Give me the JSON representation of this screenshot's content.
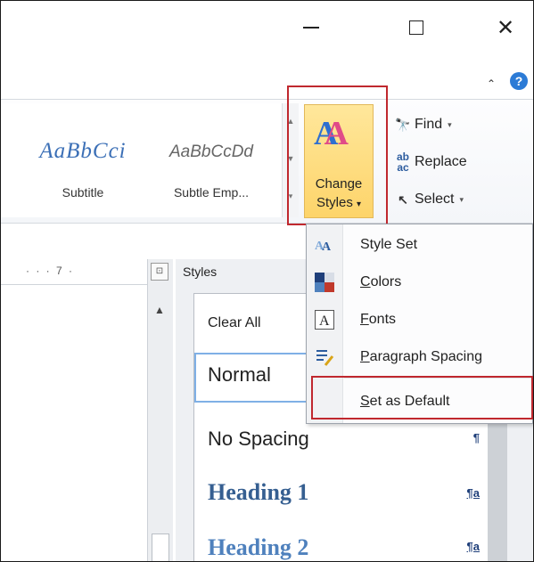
{
  "window": {
    "minimize_glyph": "—",
    "close_glyph": "✕",
    "help_glyph": "?",
    "collapse_glyph": "⌃"
  },
  "ribbon": {
    "style_gallery": [
      {
        "sample": "AaBbCci",
        "label": "Subtitle"
      },
      {
        "sample": "AaBbCcDd",
        "label": "Subtle Emp..."
      }
    ],
    "change_styles": {
      "label_line1": "Change",
      "label_line2": "Styles",
      "arrow": "▾"
    },
    "editing": [
      {
        "icon": "find-icon",
        "label": "Find",
        "arrow": "▾"
      },
      {
        "icon": "replace-icon",
        "label": "Replace",
        "arrow": ""
      },
      {
        "icon": "select-icon",
        "label": "Select",
        "arrow": "▾"
      }
    ]
  },
  "ruler": {
    "text": "·  ·  ·  7  ·"
  },
  "change_styles_menu": [
    {
      "icon": "style-set-icon",
      "label": "Style Set",
      "accel": ""
    },
    {
      "icon": "colors-icon",
      "label": "Colors",
      "accel": "C"
    },
    {
      "icon": "fonts-icon",
      "label": "Fonts",
      "accel": "F"
    },
    {
      "icon": "paragraph-spacing-icon",
      "label": "Paragraph Spacing",
      "accel": "P"
    },
    {
      "icon": "",
      "label": "Set as Default",
      "accel": "S"
    }
  ],
  "styles_pane": {
    "title": "Styles",
    "items": [
      {
        "label": "Clear All",
        "mark": ""
      },
      {
        "label": "Normal",
        "mark": "¶"
      },
      {
        "label": "No Spacing",
        "mark": "¶"
      },
      {
        "label": "Heading 1",
        "mark": "¶a"
      },
      {
        "label": "Heading 2",
        "mark": "¶a"
      }
    ]
  },
  "colors": {
    "highlight_border": "#c0282e",
    "change_styles_fill": "#fdd46a",
    "heading_blue": "#365f91"
  }
}
